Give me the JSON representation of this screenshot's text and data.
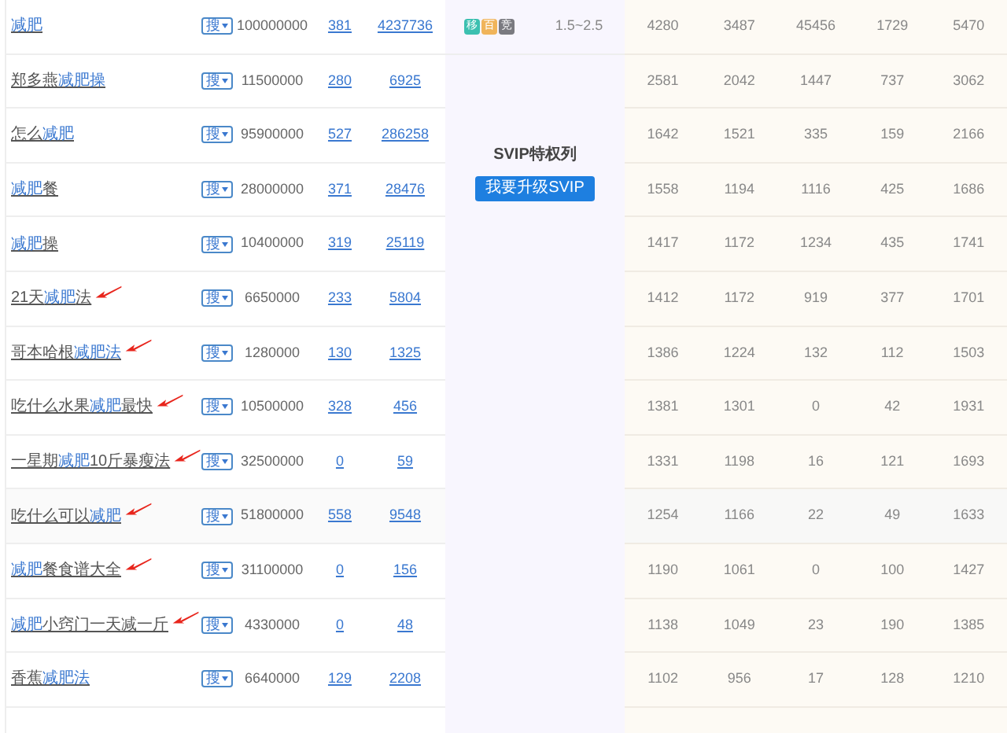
{
  "rows": [
    {
      "keyword": [
        {
          "text": "减肥",
          "highlight": true
        }
      ],
      "search_label": "搜",
      "volume": "100000000",
      "col_3": "381",
      "col_4": "4237736",
      "arrow": false,
      "metrics": [
        "4280",
        "3487",
        "45456",
        "1729",
        "5470"
      ]
    },
    {
      "keyword": [
        {
          "text": "郑多燕",
          "highlight": false
        },
        {
          "text": "减肥操",
          "highlight": true
        }
      ],
      "search_label": "搜",
      "volume": "11500000",
      "col_3": "280",
      "col_4": "6925",
      "arrow": false,
      "metrics": [
        "2581",
        "2042",
        "1447",
        "737",
        "3062"
      ]
    },
    {
      "keyword": [
        {
          "text": "怎么",
          "highlight": false
        },
        {
          "text": "减肥",
          "highlight": true
        }
      ],
      "search_label": "搜",
      "volume": "95900000",
      "col_3": "527",
      "col_4": "286258",
      "arrow": false,
      "metrics": [
        "1642",
        "1521",
        "335",
        "159",
        "2166"
      ]
    },
    {
      "keyword": [
        {
          "text": "减肥",
          "highlight": true
        },
        {
          "text": "餐",
          "highlight": false
        }
      ],
      "search_label": "搜",
      "volume": "28000000",
      "col_3": "371",
      "col_4": "28476",
      "arrow": false,
      "metrics": [
        "1558",
        "1194",
        "1116",
        "425",
        "1686"
      ]
    },
    {
      "keyword": [
        {
          "text": "减肥",
          "highlight": true
        },
        {
          "text": "操",
          "highlight": false
        }
      ],
      "search_label": "搜",
      "volume": "10400000",
      "col_3": "319",
      "col_4": "25119",
      "arrow": false,
      "metrics": [
        "1417",
        "1172",
        "1234",
        "435",
        "1741"
      ]
    },
    {
      "keyword": [
        {
          "text": "21天",
          "highlight": false
        },
        {
          "text": "减肥",
          "highlight": true
        },
        {
          "text": "法",
          "highlight": false
        }
      ],
      "search_label": "搜",
      "volume": "6650000",
      "col_3": "233",
      "col_4": "5804",
      "arrow": true,
      "metrics": [
        "1412",
        "1172",
        "919",
        "377",
        "1701"
      ]
    },
    {
      "keyword": [
        {
          "text": "哥本哈根",
          "highlight": false
        },
        {
          "text": "减肥法",
          "highlight": true
        }
      ],
      "search_label": "搜",
      "volume": "1280000",
      "col_3": "130",
      "col_4": "1325",
      "arrow": true,
      "metrics": [
        "1386",
        "1224",
        "132",
        "112",
        "1503"
      ]
    },
    {
      "keyword": [
        {
          "text": "吃什么水果",
          "highlight": false
        },
        {
          "text": "减肥",
          "highlight": true
        },
        {
          "text": "最快",
          "highlight": false
        }
      ],
      "search_label": "搜",
      "volume": "10500000",
      "col_3": "328",
      "col_4": "456",
      "arrow": true,
      "metrics": [
        "1381",
        "1301",
        "0",
        "42",
        "1931"
      ]
    },
    {
      "keyword": [
        {
          "text": "一星期",
          "highlight": false
        },
        {
          "text": "减肥",
          "highlight": true
        },
        {
          "text": "10斤暴瘦法",
          "highlight": false
        }
      ],
      "search_label": "搜",
      "volume": "32500000",
      "col_3": "0",
      "col_4": "59",
      "arrow": true,
      "metrics": [
        "1331",
        "1198",
        "16",
        "121",
        "1693"
      ]
    },
    {
      "keyword": [
        {
          "text": "吃什么可以",
          "highlight": false
        },
        {
          "text": "减肥",
          "highlight": true
        }
      ],
      "search_label": "搜",
      "volume": "51800000",
      "col_3": "558",
      "col_4": "9548",
      "arrow": true,
      "metrics": [
        "1254",
        "1166",
        "22",
        "49",
        "1633"
      ]
    },
    {
      "keyword": [
        {
          "text": "减肥",
          "highlight": true
        },
        {
          "text": "餐食谱大全",
          "highlight": false
        }
      ],
      "search_label": "搜",
      "volume": "31100000",
      "col_3": "0",
      "col_4": "156",
      "arrow": true,
      "metrics": [
        "1190",
        "1061",
        "0",
        "100",
        "1427"
      ]
    },
    {
      "keyword": [
        {
          "text": "减肥",
          "highlight": true
        },
        {
          "text": "小窍门一天减一斤",
          "highlight": false
        }
      ],
      "search_label": "搜",
      "volume": "4330000",
      "col_3": "0",
      "col_4": "48",
      "arrow": true,
      "metrics": [
        "1138",
        "1049",
        "23",
        "190",
        "1385"
      ]
    },
    {
      "keyword": [
        {
          "text": "香蕉",
          "highlight": false
        },
        {
          "text": "减肥法",
          "highlight": true
        }
      ],
      "search_label": "搜",
      "volume": "6640000",
      "col_3": "129",
      "col_4": "2208",
      "arrow": false,
      "metrics": [
        "1102",
        "956",
        "17",
        "128",
        "1210"
      ]
    }
  ],
  "first_row_extra": {
    "badges": [
      {
        "label": "移",
        "color": "#3cc0b0"
      },
      {
        "label": "百",
        "color": "#f0b45a"
      },
      {
        "label": "竞",
        "color": "#7a7a80"
      }
    ],
    "range": "1.5~2.5"
  },
  "svip": {
    "title": "SVIP特权列",
    "button": "我要升级SVIP"
  }
}
